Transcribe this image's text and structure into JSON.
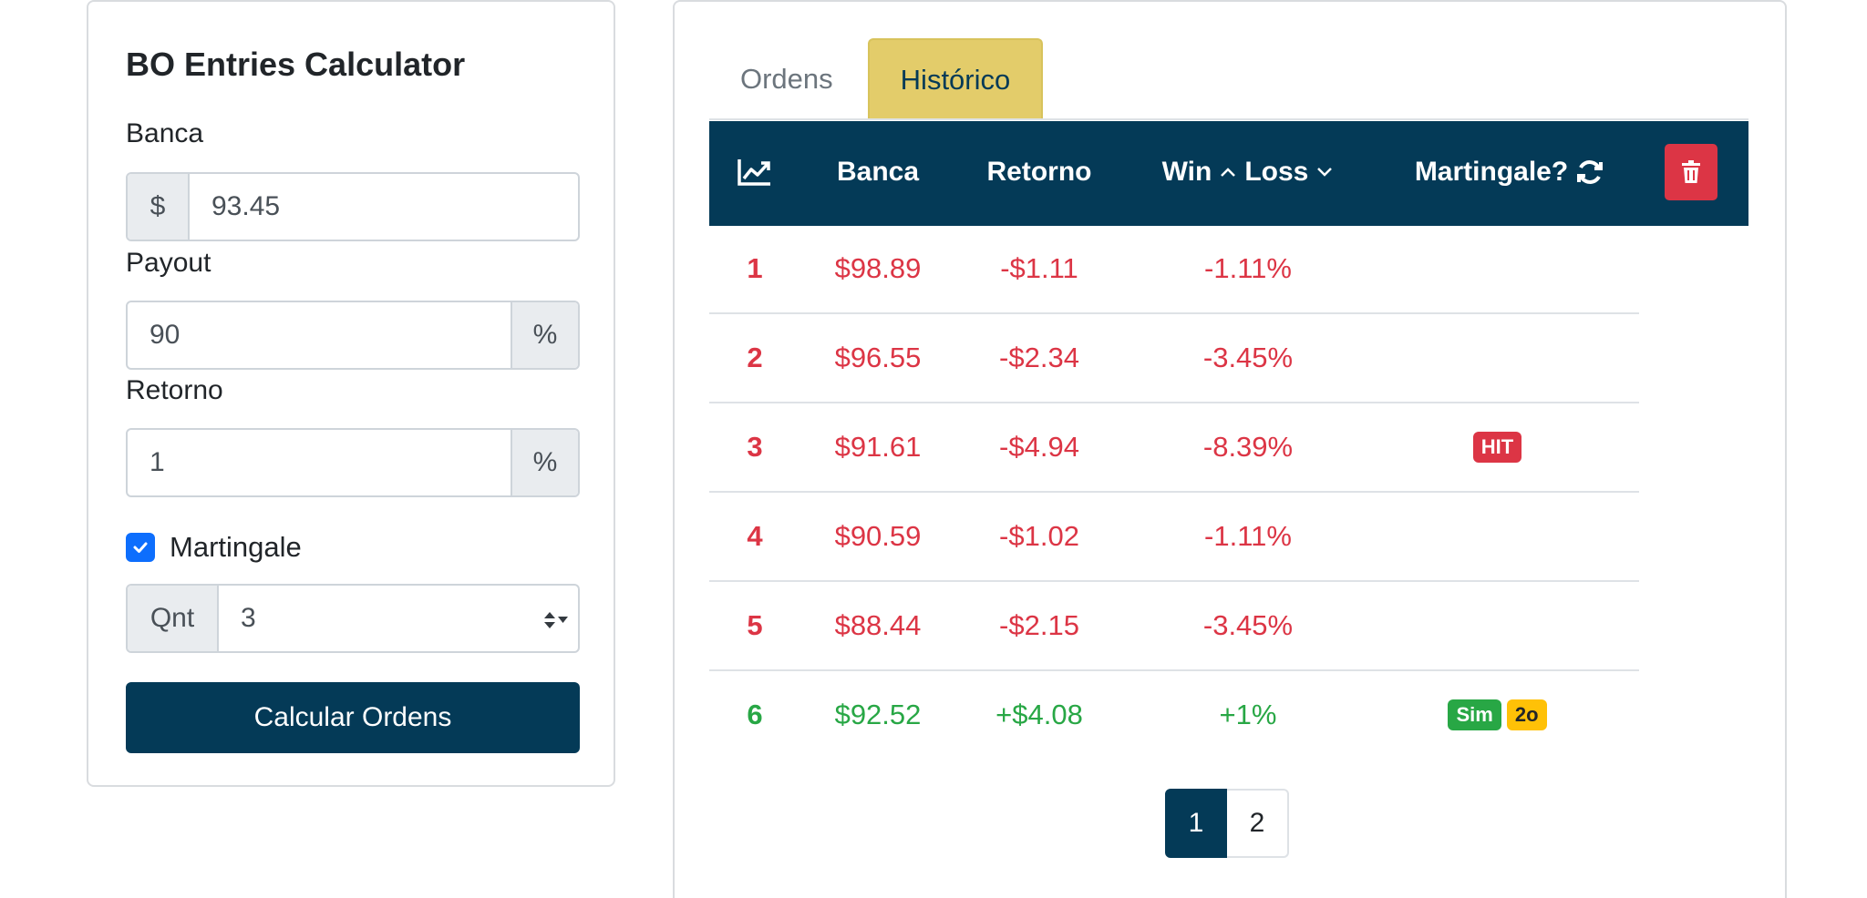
{
  "calculator": {
    "title": "BO Entries Calculator",
    "banca": {
      "label": "Banca",
      "prefix": "$",
      "value": "93.45"
    },
    "payout": {
      "label": "Payout",
      "value": "90",
      "suffix": "%"
    },
    "retorno": {
      "label": "Retorno",
      "value": "1",
      "suffix": "%"
    },
    "martingale": {
      "label": "Martingale",
      "checked": true
    },
    "qnt": {
      "label": "Qnt",
      "value": "3"
    },
    "submit_label": "Calcular Ordens"
  },
  "tabs": [
    {
      "label": "Ordens",
      "active": false
    },
    {
      "label": "Histórico",
      "active": true
    }
  ],
  "table": {
    "headers": {
      "banca": "Banca",
      "retorno": "Retorno",
      "win": "Win",
      "loss": "Loss",
      "martingale": "Martingale?"
    },
    "rows": [
      {
        "n": "1",
        "banca": "$98.89",
        "retorno": "-$1.11",
        "pct": "-1.11%",
        "result": "loss",
        "badges": []
      },
      {
        "n": "2",
        "banca": "$96.55",
        "retorno": "-$2.34",
        "pct": "-3.45%",
        "result": "loss",
        "badges": []
      },
      {
        "n": "3",
        "banca": "$91.61",
        "retorno": "-$4.94",
        "pct": "-8.39%",
        "result": "loss",
        "badges": [
          "HIT"
        ]
      },
      {
        "n": "4",
        "banca": "$90.59",
        "retorno": "-$1.02",
        "pct": "-1.11%",
        "result": "loss",
        "badges": []
      },
      {
        "n": "5",
        "banca": "$88.44",
        "retorno": "-$2.15",
        "pct": "-3.45%",
        "result": "loss",
        "badges": []
      },
      {
        "n": "6",
        "banca": "$92.52",
        "retorno": "+$4.08",
        "pct": "+1%",
        "result": "win",
        "badges": [
          "Sim",
          "2o"
        ]
      }
    ]
  },
  "pagination": {
    "pages": [
      "1",
      "2"
    ],
    "current": "1"
  },
  "colors": {
    "primary": "#043a57",
    "tab_active": "#e3cc6a",
    "loss": "#dc3545",
    "win": "#28a745",
    "badge_warning": "#ffc107",
    "checkbox": "#0d6efd"
  },
  "icons": {
    "chart": "chart-line-icon",
    "sort_up": "chevron-up-icon",
    "sort_down": "chevron-down-icon",
    "refresh": "refresh-icon",
    "trash": "trash-icon",
    "check": "check-icon",
    "select": "select-arrows-icon"
  }
}
